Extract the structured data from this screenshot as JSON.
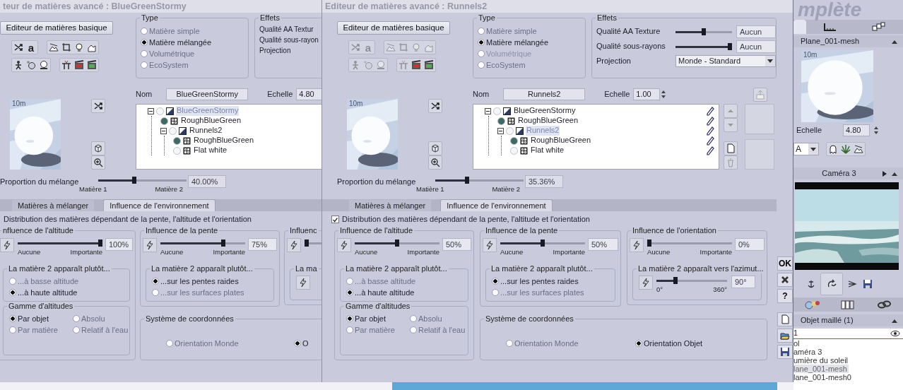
{
  "windows": [
    {
      "title": "teur de matières avancé : BlueGreenStormy",
      "basic_button": "Editeur de matières basique",
      "toolbar": {
        "disabled": false,
        "glyph": "a"
      },
      "preview": {
        "scale_mark": "10m"
      },
      "type": {
        "title": "Type",
        "options": [
          {
            "label": "Matière simple",
            "selected": false,
            "disabled": false
          },
          {
            "label": "Matière mélangée",
            "selected": true,
            "disabled": false
          },
          {
            "label": "Volumétrique",
            "selected": false,
            "disabled": false
          },
          {
            "label": "EcoSystem",
            "selected": false,
            "disabled": false
          }
        ]
      },
      "effects": {
        "title": "Effets",
        "rows": [
          {
            "label": "Qualité AA Textur"
          },
          {
            "label": "Qualité sous-rayon"
          }
        ],
        "projection": {
          "label": "Projection"
        }
      },
      "name": {
        "label": "Nom",
        "value": "BlueGreenStormy"
      },
      "scale": {
        "label": "Echelle",
        "value": "4.80"
      },
      "tree": [
        {
          "label": "BlueGreenStormy",
          "kind": "mixed",
          "color": "#f4f6f8",
          "selected": true,
          "expanded": true,
          "children": [
            {
              "label": "RoughBlueGreen",
              "kind": "simple",
              "color": "#3e6a66",
              "selected": false
            },
            {
              "label": "Runnels2",
              "kind": "mixed",
              "color": "#f4f6f8",
              "selected": false,
              "expanded": true,
              "children": [
                {
                  "label": "RoughBlueGreen",
                  "kind": "simple",
                  "color": "#3e6a66",
                  "selected": false
                },
                {
                  "label": "Flat white",
                  "kind": "simple",
                  "color": "#f4f6f8",
                  "selected": false
                }
              ]
            }
          ]
        }
      ],
      "mix": {
        "label": "Proportion du mélange",
        "level": 0.4,
        "value": "40.00%",
        "min": "Matière 1",
        "max": "Matière 2"
      },
      "tabs": [
        {
          "label": "Matières à mélanger",
          "selected": false
        },
        {
          "label": "Influence de l'environnement",
          "selected": true
        }
      ],
      "distribution": {
        "label": "Distribution des matières dépendant de la pente, l'altitude et l'orientation"
      },
      "influences": [
        {
          "title": "nfluence de l'altitude",
          "level": 1,
          "value": "100%",
          "min": "Aucune",
          "max": "Importante",
          "sub": {
            "kind": "options",
            "title": "La matière 2 apparaît plutôt...",
            "options": [
              {
                "label": "...à basse altitude",
                "selected": false
              },
              {
                "label": "...à haute altitude",
                "selected": true
              }
            ]
          },
          "range": {
            "title": "Gamme d'altitudes",
            "options": [
              {
                "label": "Par objet",
                "selected": true
              },
              {
                "label": "Absolu",
                "selected": false
              },
              {
                "label": "Par matière",
                "selected": false
              },
              {
                "label": "Relatif à l'eau",
                "selected": false
              }
            ]
          }
        },
        {
          "title": "Influence de la pente",
          "level": 0.75,
          "value": "75%",
          "min": "Aucune",
          "max": "Importante",
          "sub": {
            "kind": "options",
            "title": "La matière 2 apparaît plutôt...",
            "options": [
              {
                "label": "...sur les pentes raides",
                "selected": true
              },
              {
                "label": "...sur les surfaces plates",
                "selected": false
              }
            ]
          }
        },
        {
          "title": "Influenc",
          "level": 0,
          "sub": {
            "kind": "azimuth",
            "title": "La ma"
          }
        }
      ],
      "coordinates": {
        "title": "Système de coordonnées",
        "options": [
          {
            "label": "Orientation Monde",
            "selected": false
          },
          {
            "label": "O",
            "selected": true
          }
        ]
      }
    },
    {
      "title": "Editeur de matières avancé : Runnels2",
      "basic_button": "Editeur de matières basique",
      "toolbar": {
        "disabled": true,
        "glyph": "a"
      },
      "preview": {
        "scale_mark": "10m"
      },
      "type": {
        "title": "Type",
        "options": [
          {
            "label": "Matière simple",
            "selected": false,
            "disabled": false
          },
          {
            "label": "Matière mélangée",
            "selected": true,
            "disabled": false
          },
          {
            "label": "Volumétrique",
            "selected": false,
            "disabled": true
          },
          {
            "label": "EcoSystem",
            "selected": false,
            "disabled": false
          }
        ]
      },
      "effects": {
        "title": "Effets",
        "rows": [
          {
            "label": "Qualité AA Texture",
            "level": 0.5,
            "value": "Aucun"
          },
          {
            "label": "Qualité sous-rayons",
            "level": 1,
            "value": "Aucun"
          }
        ],
        "projection": {
          "label": "Projection",
          "value": "Monde - Standard"
        }
      },
      "name": {
        "label": "Nom",
        "value": "Runnels2"
      },
      "scale": {
        "label": "Echelle",
        "value": "1.00"
      },
      "tree_editable": true,
      "tree": [
        {
          "label": "BlueGreenStormy",
          "kind": "mixed",
          "color": "#f4f6f8",
          "selected": false,
          "expanded": true,
          "children": [
            {
              "label": "RoughBlueGreen",
              "kind": "simple",
              "color": "#3e6a66",
              "selected": false
            },
            {
              "label": "Runnels2",
              "kind": "mixed",
              "color": "#f4f6f8",
              "selected": true,
              "expanded": true,
              "children": [
                {
                  "label": "RoughBlueGreen",
                  "kind": "simple",
                  "color": "#3e6a66",
                  "selected": false
                },
                {
                  "label": "Flat white",
                  "kind": "simple",
                  "color": "#f4f6f8",
                  "selected": false
                }
              ]
            }
          ]
        }
      ],
      "mix": {
        "label": "Proportion du mélange",
        "level": 0.3536,
        "value": "35.36%",
        "min": "Matière 1",
        "max": "Matière 2"
      },
      "tabs": [
        {
          "label": "Matières à mélanger",
          "selected": false
        },
        {
          "label": "Influence de l'environnement",
          "selected": true
        }
      ],
      "distribution": {
        "label": "Distribution des matières dépendant de la pente, l'altitude et l'orientation",
        "checked": true
      },
      "influences": [
        {
          "title": "Influence de l'altitude",
          "level": 0.5,
          "value": "50%",
          "min": "Aucune",
          "max": "Importante",
          "sub": {
            "kind": "options",
            "title": "La matière 2 apparaît plutôt...",
            "options": [
              {
                "label": "...à basse altitude",
                "selected": false
              },
              {
                "label": "...à haute altitude",
                "selected": true
              }
            ]
          },
          "range": {
            "title": "Gamme d'altitudes",
            "options": [
              {
                "label": "Par objet",
                "selected": true
              },
              {
                "label": "Absolu",
                "selected": false
              },
              {
                "label": "Par matière",
                "selected": false
              },
              {
                "label": "Relatif à l'eau",
                "selected": false
              }
            ]
          }
        },
        {
          "title": "Influence de la pente",
          "level": 0.5,
          "value": "50%",
          "min": "Aucune",
          "max": "Importante",
          "sub": {
            "kind": "options",
            "title": "La matière 2 apparaît plutôt...",
            "options": [
              {
                "label": "...sur les pentes raides",
                "selected": true
              },
              {
                "label": "...sur les surfaces plates",
                "selected": false
              }
            ]
          }
        },
        {
          "title": "Influence de l'orientation",
          "level": 0,
          "value": "0%",
          "min": "Aucune",
          "max": "Importante",
          "sub": {
            "kind": "azimuth",
            "title": "La matière 2 apparaît vers l'azimut...",
            "level": 0.25,
            "value": "90°",
            "min": "0°",
            "max": "360°"
          }
        }
      ],
      "coordinates": {
        "title": "Système de coordonnées",
        "options": [
          {
            "label": "Orientation Monde",
            "selected": false
          },
          {
            "label": "Orientation Objet",
            "selected": true
          }
        ]
      },
      "side_buttons": [
        {
          "kind": "ok",
          "label": "OK"
        },
        {
          "kind": "close"
        },
        {
          "kind": "help",
          "label": "?"
        }
      ]
    }
  ],
  "side_panel": {
    "app_title": "mplète",
    "tabs": [
      {
        "kind": "blank",
        "selected": true
      },
      {
        "kind": "ruler",
        "selected": false
      },
      {
        "kind": "cubes",
        "selected": false
      }
    ],
    "object": {
      "title": "Plane_001-mesh",
      "scale_mark": "10m",
      "scale_label": "Echelle",
      "scale_value": "4.80",
      "layer": "A"
    },
    "camera": {
      "title": "Caméra 3"
    },
    "objects": {
      "title": "Objet maillé (1)",
      "filter": "1",
      "items": [
        {
          "label": "ol",
          "selected": false
        },
        {
          "label": "améra 3",
          "selected": false
        },
        {
          "label": "umière du soleil",
          "selected": false
        },
        {
          "label": "lane_001-mesh",
          "selected": true
        },
        {
          "label": "lane_001-mesh0",
          "selected": false
        }
      ]
    }
  }
}
